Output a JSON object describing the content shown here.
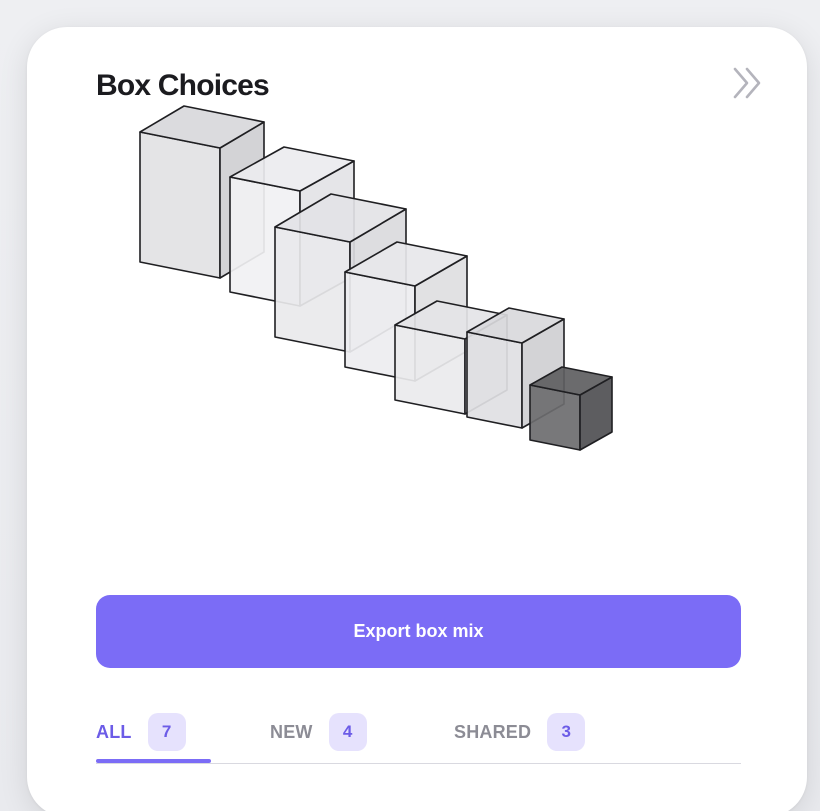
{
  "card": {
    "title": "Box Choices"
  },
  "icons": {
    "expand": "double-chevron-right-icon"
  },
  "illustration": {
    "subject": "seven isometric boxes, largest to smallest, smallest filled dark"
  },
  "export_button": {
    "label": "Export box mix"
  },
  "tabs": [
    {
      "label": "ALL",
      "count": "7",
      "active": true
    },
    {
      "label": "NEW",
      "count": "4",
      "active": false
    },
    {
      "label": "SHARED",
      "count": "3",
      "active": false
    }
  ],
  "colors": {
    "accent": "#7b6cf6",
    "accent_text": "#6c5ce7",
    "badge_bg": "#e6e2fd",
    "title": "#1b1b1f",
    "muted": "#8c8c95"
  }
}
